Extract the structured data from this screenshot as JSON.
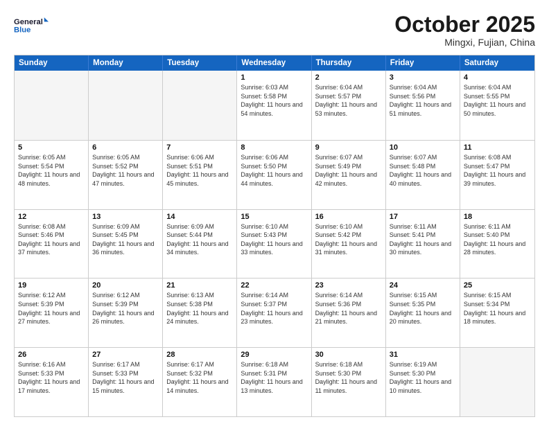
{
  "header": {
    "logo_line1": "General",
    "logo_line2": "Blue",
    "month": "October 2025",
    "location": "Mingxi, Fujian, China"
  },
  "weekdays": [
    "Sunday",
    "Monday",
    "Tuesday",
    "Wednesday",
    "Thursday",
    "Friday",
    "Saturday"
  ],
  "weeks": [
    [
      {
        "day": "",
        "sunrise": "",
        "sunset": "",
        "daylight": ""
      },
      {
        "day": "",
        "sunrise": "",
        "sunset": "",
        "daylight": ""
      },
      {
        "day": "",
        "sunrise": "",
        "sunset": "",
        "daylight": ""
      },
      {
        "day": "1",
        "sunrise": "Sunrise: 6:03 AM",
        "sunset": "Sunset: 5:58 PM",
        "daylight": "Daylight: 11 hours and 54 minutes."
      },
      {
        "day": "2",
        "sunrise": "Sunrise: 6:04 AM",
        "sunset": "Sunset: 5:57 PM",
        "daylight": "Daylight: 11 hours and 53 minutes."
      },
      {
        "day": "3",
        "sunrise": "Sunrise: 6:04 AM",
        "sunset": "Sunset: 5:56 PM",
        "daylight": "Daylight: 11 hours and 51 minutes."
      },
      {
        "day": "4",
        "sunrise": "Sunrise: 6:04 AM",
        "sunset": "Sunset: 5:55 PM",
        "daylight": "Daylight: 11 hours and 50 minutes."
      }
    ],
    [
      {
        "day": "5",
        "sunrise": "Sunrise: 6:05 AM",
        "sunset": "Sunset: 5:54 PM",
        "daylight": "Daylight: 11 hours and 48 minutes."
      },
      {
        "day": "6",
        "sunrise": "Sunrise: 6:05 AM",
        "sunset": "Sunset: 5:52 PM",
        "daylight": "Daylight: 11 hours and 47 minutes."
      },
      {
        "day": "7",
        "sunrise": "Sunrise: 6:06 AM",
        "sunset": "Sunset: 5:51 PM",
        "daylight": "Daylight: 11 hours and 45 minutes."
      },
      {
        "day": "8",
        "sunrise": "Sunrise: 6:06 AM",
        "sunset": "Sunset: 5:50 PM",
        "daylight": "Daylight: 11 hours and 44 minutes."
      },
      {
        "day": "9",
        "sunrise": "Sunrise: 6:07 AM",
        "sunset": "Sunset: 5:49 PM",
        "daylight": "Daylight: 11 hours and 42 minutes."
      },
      {
        "day": "10",
        "sunrise": "Sunrise: 6:07 AM",
        "sunset": "Sunset: 5:48 PM",
        "daylight": "Daylight: 11 hours and 40 minutes."
      },
      {
        "day": "11",
        "sunrise": "Sunrise: 6:08 AM",
        "sunset": "Sunset: 5:47 PM",
        "daylight": "Daylight: 11 hours and 39 minutes."
      }
    ],
    [
      {
        "day": "12",
        "sunrise": "Sunrise: 6:08 AM",
        "sunset": "Sunset: 5:46 PM",
        "daylight": "Daylight: 11 hours and 37 minutes."
      },
      {
        "day": "13",
        "sunrise": "Sunrise: 6:09 AM",
        "sunset": "Sunset: 5:45 PM",
        "daylight": "Daylight: 11 hours and 36 minutes."
      },
      {
        "day": "14",
        "sunrise": "Sunrise: 6:09 AM",
        "sunset": "Sunset: 5:44 PM",
        "daylight": "Daylight: 11 hours and 34 minutes."
      },
      {
        "day": "15",
        "sunrise": "Sunrise: 6:10 AM",
        "sunset": "Sunset: 5:43 PM",
        "daylight": "Daylight: 11 hours and 33 minutes."
      },
      {
        "day": "16",
        "sunrise": "Sunrise: 6:10 AM",
        "sunset": "Sunset: 5:42 PM",
        "daylight": "Daylight: 11 hours and 31 minutes."
      },
      {
        "day": "17",
        "sunrise": "Sunrise: 6:11 AM",
        "sunset": "Sunset: 5:41 PM",
        "daylight": "Daylight: 11 hours and 30 minutes."
      },
      {
        "day": "18",
        "sunrise": "Sunrise: 6:11 AM",
        "sunset": "Sunset: 5:40 PM",
        "daylight": "Daylight: 11 hours and 28 minutes."
      }
    ],
    [
      {
        "day": "19",
        "sunrise": "Sunrise: 6:12 AM",
        "sunset": "Sunset: 5:39 PM",
        "daylight": "Daylight: 11 hours and 27 minutes."
      },
      {
        "day": "20",
        "sunrise": "Sunrise: 6:12 AM",
        "sunset": "Sunset: 5:39 PM",
        "daylight": "Daylight: 11 hours and 26 minutes."
      },
      {
        "day": "21",
        "sunrise": "Sunrise: 6:13 AM",
        "sunset": "Sunset: 5:38 PM",
        "daylight": "Daylight: 11 hours and 24 minutes."
      },
      {
        "day": "22",
        "sunrise": "Sunrise: 6:14 AM",
        "sunset": "Sunset: 5:37 PM",
        "daylight": "Daylight: 11 hours and 23 minutes."
      },
      {
        "day": "23",
        "sunrise": "Sunrise: 6:14 AM",
        "sunset": "Sunset: 5:36 PM",
        "daylight": "Daylight: 11 hours and 21 minutes."
      },
      {
        "day": "24",
        "sunrise": "Sunrise: 6:15 AM",
        "sunset": "Sunset: 5:35 PM",
        "daylight": "Daylight: 11 hours and 20 minutes."
      },
      {
        "day": "25",
        "sunrise": "Sunrise: 6:15 AM",
        "sunset": "Sunset: 5:34 PM",
        "daylight": "Daylight: 11 hours and 18 minutes."
      }
    ],
    [
      {
        "day": "26",
        "sunrise": "Sunrise: 6:16 AM",
        "sunset": "Sunset: 5:33 PM",
        "daylight": "Daylight: 11 hours and 17 minutes."
      },
      {
        "day": "27",
        "sunrise": "Sunrise: 6:17 AM",
        "sunset": "Sunset: 5:33 PM",
        "daylight": "Daylight: 11 hours and 15 minutes."
      },
      {
        "day": "28",
        "sunrise": "Sunrise: 6:17 AM",
        "sunset": "Sunset: 5:32 PM",
        "daylight": "Daylight: 11 hours and 14 minutes."
      },
      {
        "day": "29",
        "sunrise": "Sunrise: 6:18 AM",
        "sunset": "Sunset: 5:31 PM",
        "daylight": "Daylight: 11 hours and 13 minutes."
      },
      {
        "day": "30",
        "sunrise": "Sunrise: 6:18 AM",
        "sunset": "Sunset: 5:30 PM",
        "daylight": "Daylight: 11 hours and 11 minutes."
      },
      {
        "day": "31",
        "sunrise": "Sunrise: 6:19 AM",
        "sunset": "Sunset: 5:30 PM",
        "daylight": "Daylight: 11 hours and 10 minutes."
      },
      {
        "day": "",
        "sunrise": "",
        "sunset": "",
        "daylight": ""
      }
    ]
  ]
}
